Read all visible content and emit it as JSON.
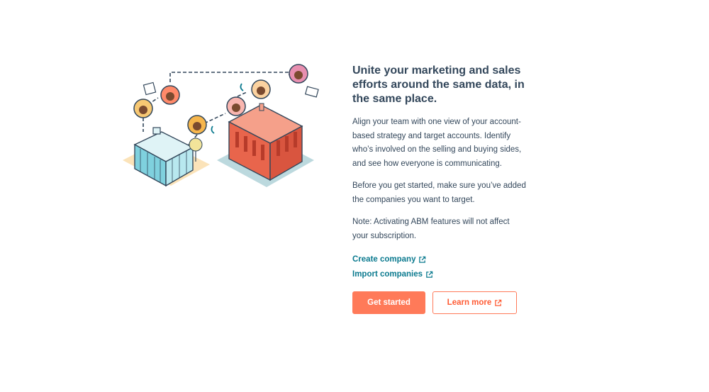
{
  "content": {
    "heading": "Unite your marketing and sales efforts around the same data, in the same place.",
    "paragraph_1": "Align your team with one view of your account-based strategy and target accounts. Identify who’s involved on the selling and buying sides, and see how everyone is communicating.",
    "paragraph_2": "Before you get started, make sure you’ve added the companies you want to target.",
    "paragraph_3": "Note: Activating ABM features will not affect your subscription."
  },
  "links": {
    "create_company": "Create company",
    "import_companies": "Import companies"
  },
  "buttons": {
    "get_started": "Get started",
    "learn_more": "Learn more"
  },
  "colors": {
    "accent": "#ff7a59",
    "link": "#0b7a8f",
    "text": "#33475b"
  },
  "icons": [
    "external-link-icon"
  ]
}
